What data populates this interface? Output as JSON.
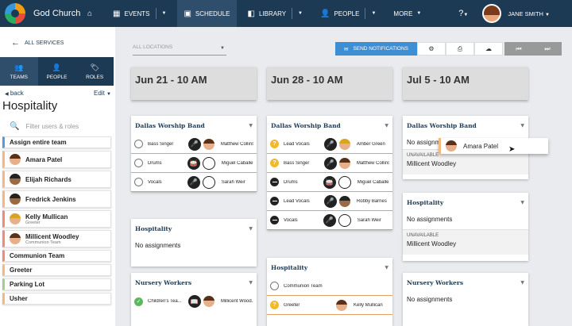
{
  "header": {
    "church_name": "God Church",
    "nav": [
      {
        "label": "EVENTS",
        "icon": "calendar-icon"
      },
      {
        "label": "SCHEDULE",
        "icon": "schedule-icon"
      },
      {
        "label": "LIBRARY",
        "icon": "library-icon"
      },
      {
        "label": "PEOPLE",
        "icon": "people-icon"
      },
      {
        "label": "MORE",
        "icon": ""
      }
    ],
    "user_name": "JANE SMITH"
  },
  "sidebar": {
    "all_services": "ALL SERVICES",
    "tabs": [
      {
        "label": "TEAMS",
        "icon": "teams-icon"
      },
      {
        "label": "PEOPLE",
        "icon": "person-icon"
      },
      {
        "label": "ROLES",
        "icon": "tag-icon"
      }
    ],
    "back": "back",
    "edit": "Edit",
    "team_title": "Hospitality",
    "filter_placeholder": "Filter users & roles",
    "assign_all": "Assign entire team",
    "people": [
      {
        "name": "Amara Patel",
        "sub": ""
      },
      {
        "name": "Elijah Richards",
        "sub": ""
      },
      {
        "name": "Fredrick Jenkins",
        "sub": ""
      },
      {
        "name": "Kelly Mullican",
        "sub": "Greeter"
      },
      {
        "name": "Millicent Woodley",
        "sub": "Communion Team"
      }
    ],
    "teams": [
      "Communion Team",
      "Greeter",
      "Parking Lot",
      "Usher"
    ]
  },
  "toolbar": {
    "location_placeholder": "ALL LOCATIONS",
    "send_notifications": "SEND NOTIFICATIONS"
  },
  "columns": [
    {
      "date": "Jun 21 - 10 AM",
      "cards": [
        {
          "title": "Dallas Worship Band",
          "rows": [
            {
              "role": "Bass Singer",
              "status": "open",
              "person": "Matthew Collins"
            },
            {
              "role": "Drums",
              "status": "open",
              "person": "Miguel Caballe..."
            },
            {
              "role": "Vocals",
              "status": "open",
              "person": "Sarah Weir"
            }
          ]
        },
        {
          "title": "Hospitality",
          "no_assignments": "No assignments"
        },
        {
          "title": "Nursery Workers",
          "rows": [
            {
              "role": "Children's Tea...",
              "status": "ok",
              "person": "Millicent Wood..."
            }
          ]
        }
      ]
    },
    {
      "date": "Jun 28 - 10 AM",
      "cards": [
        {
          "title": "Dallas Worship Band",
          "rows": [
            {
              "role": "Lead Vocals",
              "status": "q",
              "person": "Amber Green"
            },
            {
              "role": "Bass Singer",
              "status": "q",
              "person": "Matthew Collins"
            },
            {
              "role": "Drums",
              "status": "no",
              "person": "Miguel Caballe..."
            },
            {
              "role": "Lead Vocals",
              "status": "no",
              "person": "Robby Barnes"
            },
            {
              "role": "Vocals",
              "status": "no",
              "person": "Sarah Weir"
            }
          ]
        },
        {
          "title": "Hospitality",
          "rows": [
            {
              "role": "Communion Team",
              "status": "open",
              "person": ""
            },
            {
              "role": "Greeter",
              "status": "q",
              "person": "Kelly Mullican"
            }
          ]
        }
      ]
    },
    {
      "date": "Jul 5 - 10 AM",
      "cards": [
        {
          "title": "Dallas Worship Band",
          "no_assignments": "No assignme",
          "unavailable_label": "UNAVAILABLE",
          "unavailable_person": "Millicent Woodley"
        },
        {
          "title": "Hospitality",
          "no_assignments": "No assignments",
          "unavailable_label": "UNAVAILABLE",
          "unavailable_person": "Millicent Woodley"
        },
        {
          "title": "Nursery Workers",
          "no_assignments": "No assignments"
        }
      ]
    }
  ],
  "drag_item": {
    "name": "Amara Patel"
  }
}
